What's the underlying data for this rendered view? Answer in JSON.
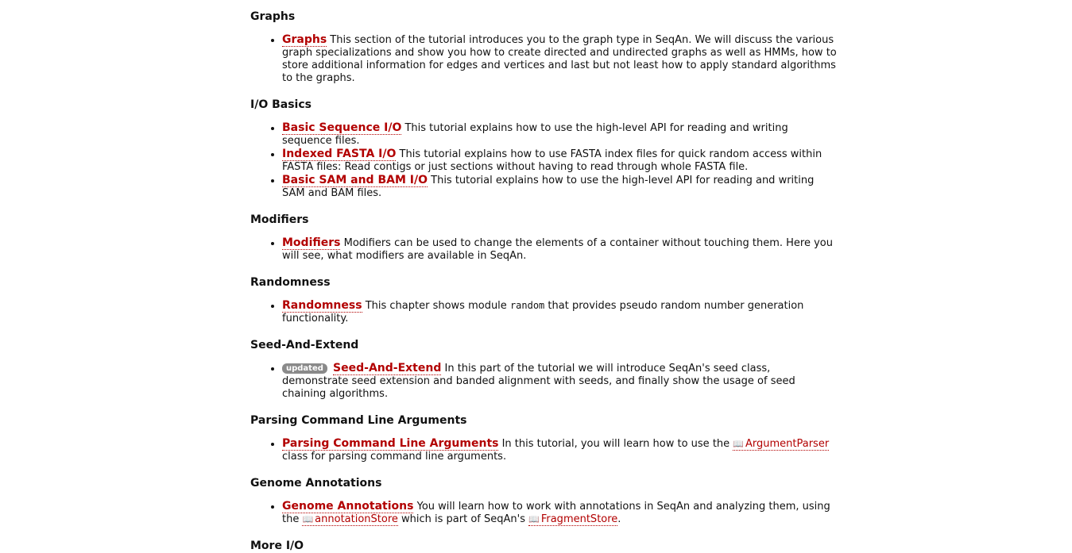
{
  "sections": [
    {
      "title": "Graphs",
      "items": [
        {
          "link": "Graphs",
          "text": " This section of the tutorial introduces you to the graph type in SeqAn. We will discuss the various graph specializations and show you how to create directed and undirected graphs as well as HMMs, how to store additional information for edges and vertices and last but not least how to apply standard algorithms to the graphs."
        }
      ]
    },
    {
      "title": "I/O Basics",
      "items": [
        {
          "link": "Basic Sequence I/O",
          "text": " This tutorial explains how to use the high-level API for reading and writing sequence files."
        },
        {
          "link": "Indexed FASTA I/O",
          "text": " This tutorial explains how to use FASTA index files for quick random access within FASTA files: Read contigs or just sections without having to read through whole FASTA file."
        },
        {
          "link": "Basic SAM and BAM I/O",
          "text": " This tutorial explains how to use the high-level API for reading and writing SAM and BAM files."
        }
      ]
    },
    {
      "title": "Modifiers",
      "items": [
        {
          "link": "Modifiers",
          "text": " Modifiers can be used to change the elements of a container without touching them. Here you will see, what modifiers are available in SeqAn."
        }
      ]
    },
    {
      "title": "Randomness",
      "items": [
        {
          "link": "Randomness",
          "text_before": " This chapter shows module ",
          "code": "random",
          "text": " that provides pseudo random number generation functionality."
        }
      ]
    },
    {
      "title": "Seed-And-Extend",
      "items": [
        {
          "badge": "updated",
          "link": "Seed-And-Extend",
          "text": " In this part of the tutorial we will introduce SeqAn's seed class, demonstrate seed extension and banded alignment with seeds, and finally show the usage of seed chaining algorithms."
        }
      ]
    },
    {
      "title": "Parsing Command Line Arguments",
      "items": [
        {
          "link": "Parsing Command Line Arguments",
          "text_before": " In this tutorial, you will learn how to use the ",
          "ref": "ArgumentParser",
          "text": " class for parsing command line arguments."
        }
      ]
    },
    {
      "title": "Genome Annotations",
      "items": [
        {
          "link": "Genome Annotations",
          "text_before": " You will learn how to work with annotations in SeqAn and analyzing them, using the ",
          "ref": "annotationStore",
          "text_mid": " which is part of SeqAn's ",
          "ref2": "FragmentStore",
          "text": "."
        }
      ]
    },
    {
      "title": "More I/O",
      "items": []
    }
  ]
}
